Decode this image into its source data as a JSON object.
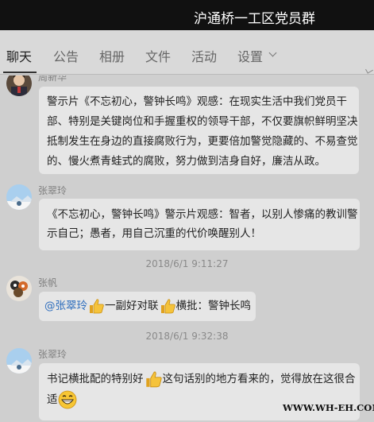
{
  "window": {
    "title": "沪通桥一工区党员群"
  },
  "tabs": [
    {
      "label": "聊天"
    },
    {
      "label": "公告"
    },
    {
      "label": "相册"
    },
    {
      "label": "文件"
    },
    {
      "label": "活动"
    },
    {
      "label": "设置"
    }
  ],
  "messages": [
    {
      "sender": "周新华",
      "lines": [
        "警示片《不忘初心，警钟长鸣》观感：在现实生活中我们党员干",
        "部、特别是关键岗位和手握重权的领导干部，不仅要旗帜鲜明坚决",
        "抵制发生在身边的直接腐败行为，更要倍加警觉隐藏的、不易查觉",
        "的、慢火煮青蛙式的腐败，努力做到洁身自好，廉洁从政。"
      ]
    },
    {
      "sender": "张翠玲",
      "lines": [
        "《不忘初心，警钟长鸣》警示片观感：智者，以别人惨痛的教训警",
        "示自己；愚者，用自己沉重的代价唤醒别人！"
      ]
    },
    {
      "time": "2018/6/1 9:11:27",
      "sender": "张帆",
      "mention": "@张翠玲",
      "part1": "一副好对联",
      "part2": "横批：警钟长鸣"
    },
    {
      "time": "2018/6/1 9:32:38",
      "sender": "张翠玲",
      "line1_a": "书记横批配的特别好",
      "line1_b": "这句话别的地方看来的，觉得放在这很合",
      "line2": "适"
    }
  ],
  "watermark": "WWW.WH-EH.COM",
  "colors": {
    "titlebar": "#111111",
    "background": "#cfcfcf",
    "bubble": "#e6e6e6",
    "mention": "#2f6ebd"
  },
  "icons": [
    "thumbs-up-emoji",
    "grin-emoji",
    "chevron-down-icon"
  ]
}
